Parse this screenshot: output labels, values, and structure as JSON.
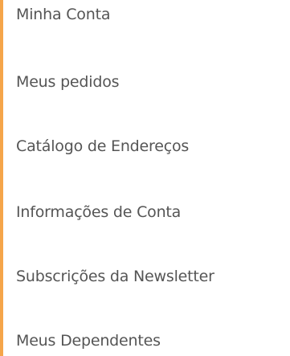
{
  "colors": {
    "accent": "#f5a54a",
    "text": "#555555"
  },
  "nav": {
    "items": [
      {
        "label": "Minha Conta"
      },
      {
        "label": "Meus pedidos"
      },
      {
        "label": "Catálogo de Endereços"
      },
      {
        "label": "Informações de Conta"
      },
      {
        "label": "Subscrições da Newsletter"
      },
      {
        "label": "Meus Dependentes"
      }
    ]
  }
}
